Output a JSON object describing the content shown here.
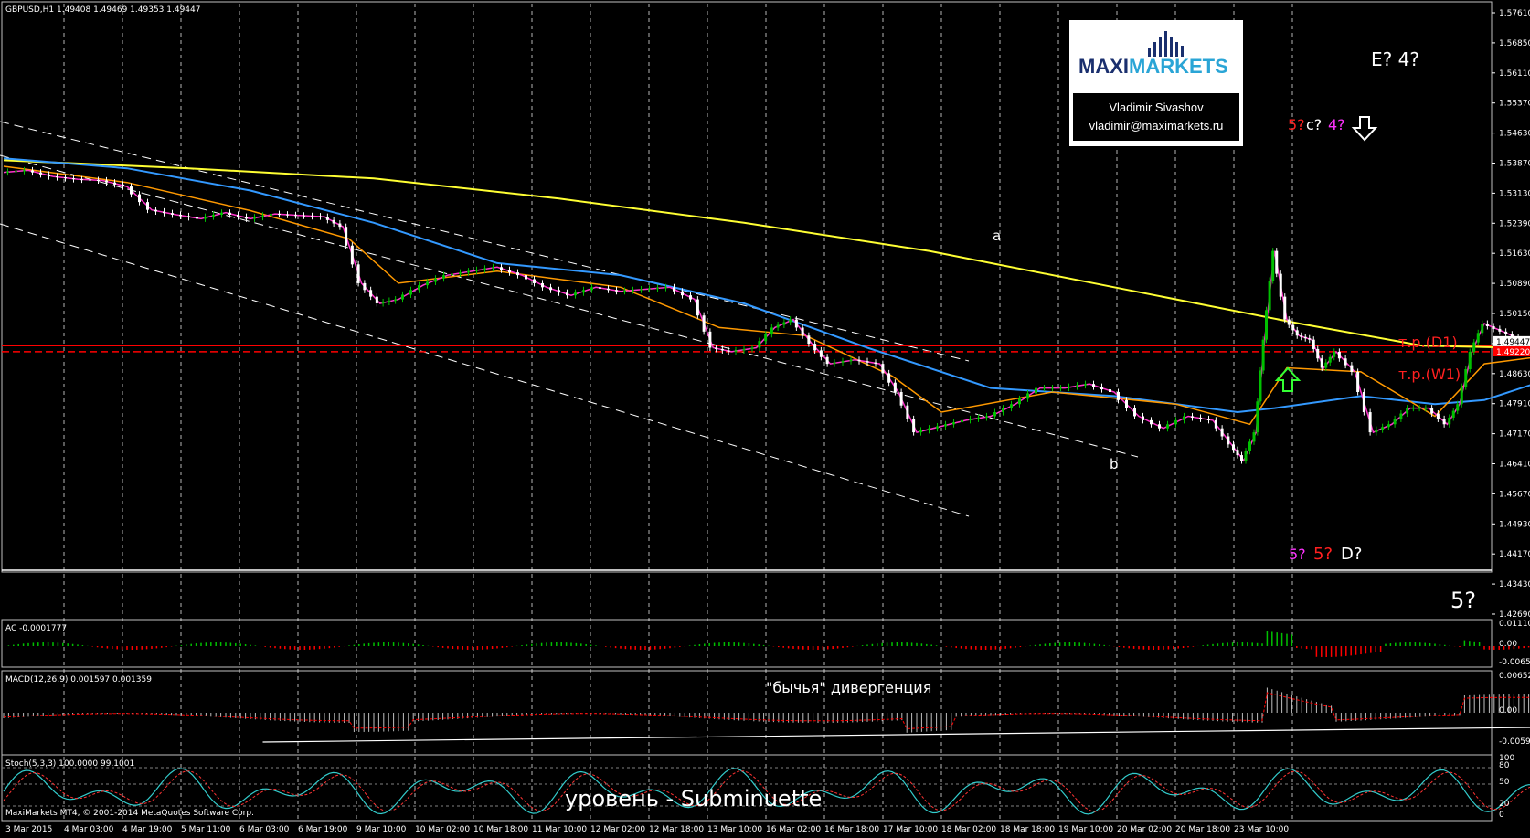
{
  "header": {
    "symbol_line": "GBPUSD,H1  1.49408 1.49469 1.49353 1.49447"
  },
  "logo": {
    "brand_left": "MAXI",
    "brand_right": "MARKETS",
    "author": "Vladimir Sivashov",
    "email": "vladimir@maximarkets.ru"
  },
  "colors": {
    "background": "#000000",
    "candle_up": "#00c000",
    "candle_down": "#ffffff",
    "ma_yellow": "#ffff33",
    "ma_blue": "#3399ff",
    "ma_orange": "#ff9900",
    "ma_magenta": "#ff33cc",
    "level_red": "#ff0000",
    "macd_signal": "#ff0000",
    "stoch_main": "#33cccc"
  },
  "chart_data": {
    "type": "line",
    "title": "GBPUSD,H1",
    "ohlc_last": {
      "open": 1.49408,
      "high": 1.49469,
      "low": 1.49353,
      "close": 1.49447
    },
    "y_ticks": [
      "1.57610",
      "1.56850",
      "1.56110",
      "1.55370",
      "1.54630",
      "1.53870",
      "1.53130",
      "1.52390",
      "1.51630",
      "1.50890",
      "1.50150",
      "1.49447",
      "1.48630",
      "1.47910",
      "1.47170",
      "1.46410",
      "1.45670",
      "1.44930",
      "1.44170",
      "1.43430",
      "1.42690"
    ],
    "current_price_label": "1.49447",
    "level_price_label": "1.49220",
    "x_ticks": [
      "3 Mar 2015",
      "4 Mar 03:00",
      "4 Mar 19:00",
      "5 Mar 11:00",
      "6 Mar 03:00",
      "6 Mar 19:00",
      "9 Mar 10:00",
      "10 Mar 02:00",
      "10 Mar 18:00",
      "11 Mar 10:00",
      "12 Mar 02:00",
      "12 Mar 18:00",
      "13 Mar 10:00",
      "16 Mar 02:00",
      "16 Mar 18:00",
      "17 Mar 10:00",
      "18 Mar 02:00",
      "18 Mar 18:00",
      "19 Mar 10:00",
      "20 Mar 02:00",
      "20 Mar 18:00",
      "23 Mar 10:00"
    ],
    "price_path": [
      [
        0,
        1.5365
      ],
      [
        20,
        1.537
      ],
      [
        40,
        1.5355
      ],
      [
        60,
        1.5348
      ],
      [
        80,
        1.5345
      ],
      [
        100,
        1.533
      ],
      [
        120,
        1.5272
      ],
      [
        140,
        1.526
      ],
      [
        160,
        1.525
      ],
      [
        180,
        1.5265
      ],
      [
        200,
        1.525
      ],
      [
        220,
        1.5262
      ],
      [
        240,
        1.5258
      ],
      [
        260,
        1.5255
      ],
      [
        275,
        1.523
      ],
      [
        290,
        1.509
      ],
      [
        305,
        1.504
      ],
      [
        320,
        1.505
      ],
      [
        340,
        1.5085
      ],
      [
        360,
        1.511
      ],
      [
        380,
        1.512
      ],
      [
        400,
        1.513
      ],
      [
        420,
        1.511
      ],
      [
        440,
        1.508
      ],
      [
        460,
        1.506
      ],
      [
        480,
        1.508
      ],
      [
        500,
        1.507
      ],
      [
        520,
        1.5075
      ],
      [
        540,
        1.508
      ],
      [
        560,
        1.505
      ],
      [
        575,
        1.493
      ],
      [
        590,
        1.492
      ],
      [
        610,
        1.493
      ],
      [
        625,
        1.498
      ],
      [
        640,
        1.5
      ],
      [
        655,
        1.494
      ],
      [
        670,
        1.489
      ],
      [
        690,
        1.49
      ],
      [
        710,
        1.489
      ],
      [
        725,
        1.482
      ],
      [
        740,
        1.472
      ],
      [
        760,
        1.4735
      ],
      [
        780,
        1.475
      ],
      [
        800,
        1.476
      ],
      [
        820,
        1.479
      ],
      [
        840,
        1.483
      ],
      [
        860,
        1.483
      ],
      [
        880,
        1.484
      ],
      [
        900,
        1.482
      ],
      [
        920,
        1.476
      ],
      [
        940,
        1.473
      ],
      [
        960,
        1.476
      ],
      [
        980,
        1.475
      ],
      [
        995,
        1.469
      ],
      [
        1005,
        1.465
      ],
      [
        1015,
        1.472
      ],
      [
        1022,
        1.495
      ],
      [
        1030,
        1.517
      ],
      [
        1040,
        1.5
      ],
      [
        1050,
        1.496
      ],
      [
        1060,
        1.495
      ],
      [
        1070,
        1.488
      ],
      [
        1080,
        1.492
      ],
      [
        1095,
        1.487
      ],
      [
        1110,
        1.472
      ],
      [
        1125,
        1.474
      ],
      [
        1140,
        1.478
      ],
      [
        1155,
        1.478
      ],
      [
        1170,
        1.474
      ],
      [
        1180,
        1.479
      ],
      [
        1190,
        1.492
      ],
      [
        1200,
        1.499
      ],
      [
        1215,
        1.497
      ],
      [
        1230,
        1.495
      ],
      [
        1245,
        1.495
      ],
      [
        1255,
        1.487
      ],
      [
        1265,
        1.493
      ],
      [
        1280,
        1.493
      ],
      [
        1295,
        1.4945
      ]
    ],
    "ma_yellow": [
      [
        0,
        1.5395
      ],
      [
        150,
        1.5375
      ],
      [
        300,
        1.535
      ],
      [
        450,
        1.53
      ],
      [
        600,
        1.524
      ],
      [
        750,
        1.517
      ],
      [
        900,
        1.508
      ],
      [
        1050,
        1.499
      ],
      [
        1150,
        1.4935
      ],
      [
        1300,
        1.4925
      ]
    ],
    "ma_blue": [
      [
        0,
        1.54
      ],
      [
        100,
        1.5375
      ],
      [
        200,
        1.532
      ],
      [
        300,
        1.524
      ],
      [
        400,
        1.514
      ],
      [
        500,
        1.511
      ],
      [
        600,
        1.504
      ],
      [
        700,
        1.493
      ],
      [
        800,
        1.483
      ],
      [
        900,
        1.481
      ],
      [
        1000,
        1.477
      ],
      [
        1030,
        1.478
      ],
      [
        1100,
        1.481
      ],
      [
        1160,
        1.479
      ],
      [
        1200,
        1.48
      ],
      [
        1260,
        1.486
      ],
      [
        1300,
        1.488
      ]
    ],
    "ma_orange": [
      [
        0,
        1.538
      ],
      [
        100,
        1.534
      ],
      [
        200,
        1.527
      ],
      [
        280,
        1.52
      ],
      [
        320,
        1.509
      ],
      [
        400,
        1.512
      ],
      [
        500,
        1.508
      ],
      [
        580,
        1.498
      ],
      [
        650,
        1.496
      ],
      [
        720,
        1.486
      ],
      [
        760,
        1.477
      ],
      [
        850,
        1.482
      ],
      [
        950,
        1.479
      ],
      [
        1010,
        1.474
      ],
      [
        1040,
        1.488
      ],
      [
        1100,
        1.487
      ],
      [
        1160,
        1.476
      ],
      [
        1200,
        1.489
      ],
      [
        1250,
        1.491
      ],
      [
        1300,
        1.492
      ]
    ],
    "levels": [
      {
        "label": "т.р.(D1)",
        "price": 1.4935,
        "color": "#ff0000"
      },
      {
        "label": "т.р.(W1)",
        "price": 1.4922,
        "color": "#ff0000"
      }
    ],
    "wave_labels": [
      {
        "text": "a",
        "x": 1022,
        "y": 1.5225,
        "color": "#ffffff"
      },
      {
        "text": "b",
        "x": 1115,
        "y": 1.4655,
        "color": "#ffffff"
      }
    ],
    "annotations": [
      "E? 4?",
      "5? c? 4?",
      "5? 5? D?",
      "5?",
      "т.р.(D1)",
      "т.р.(W1)",
      "\"бычья\" дивергенция",
      "уровень - Subminuette"
    ],
    "indicators": {
      "ac": {
        "label": "AC -0.0001777",
        "ticks": [
          "0.011105",
          "0.00",
          "-0.006575"
        ]
      },
      "macd": {
        "label": "MACD(12,26,9) 0.001597 0.001359",
        "ticks": [
          "0.006526",
          "0.00",
          "-0.005956"
        ]
      },
      "stoch": {
        "label": "Stoch(5,3,3) 100.0000 99.1001",
        "ticks": [
          "100",
          "80",
          "50",
          "20",
          "0"
        ]
      }
    },
    "footer": "MaxiMarkets MT4, © 2001-2014 MetaQuotes Software Corp."
  },
  "text": {
    "e4": "E? 4?",
    "c4_a": "5?",
    "c4_b": "c?",
    "c4_c": "4?",
    "d_a": "5?",
    "d_b": "5?",
    "d_c": "D?",
    "five": "5?",
    "level_d1": "т.р.(D1)",
    "level_w1": "т.р.(W1)",
    "divergence": "\"бычья\" дивергенция",
    "level_note": "уровень - Subminuette",
    "wave_a": "a",
    "wave_b": "b"
  }
}
